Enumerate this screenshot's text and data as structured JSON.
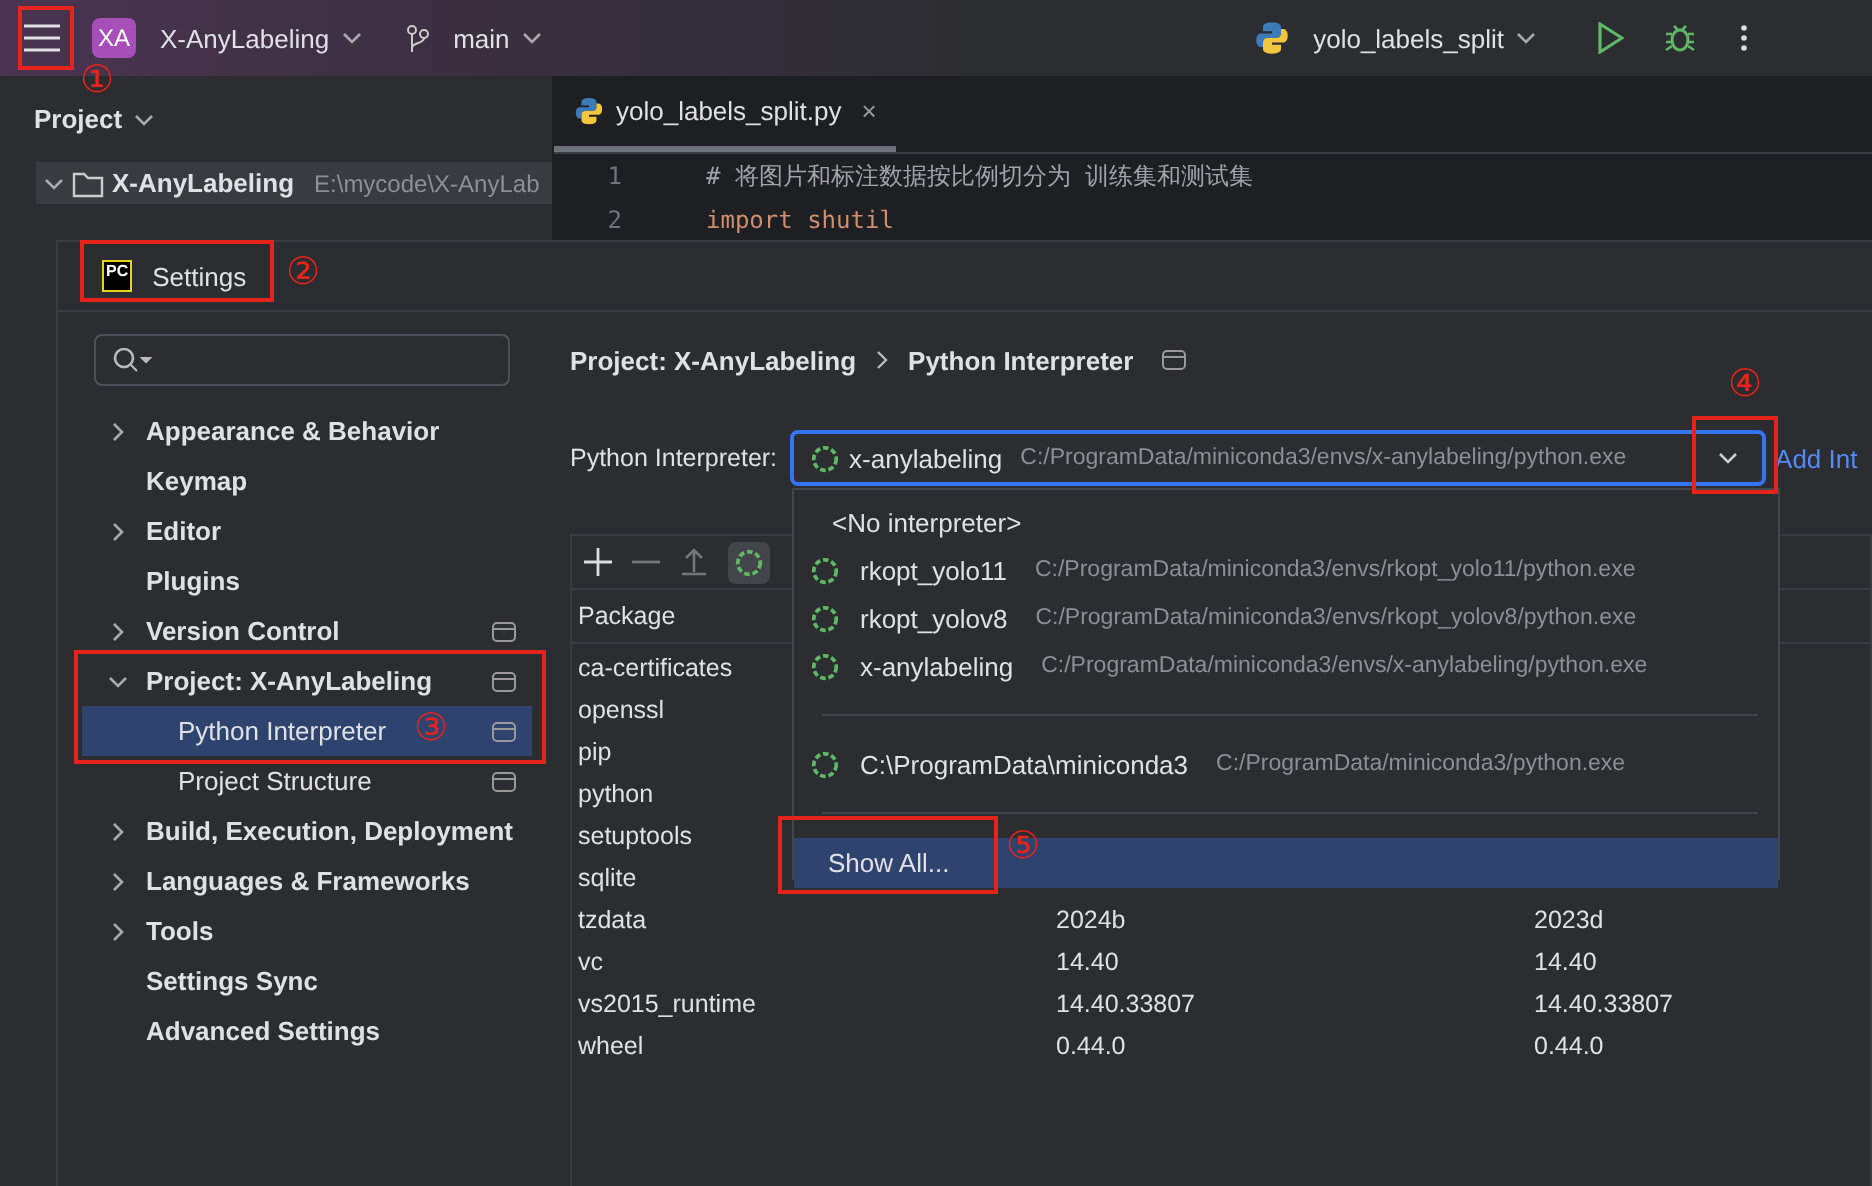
{
  "top_bar": {
    "project_badge": "XA",
    "project": "X-AnyLabeling",
    "branch": "main",
    "run_config": "yolo_labels_split"
  },
  "project_panel": {
    "title": "Project",
    "tree": [
      {
        "name": "X-AnyLabeling",
        "path": "E:\\mycode\\X-AnyLab",
        "expanded": true
      }
    ]
  },
  "editor": {
    "tabs": [
      {
        "label": "yolo_labels_split.py",
        "close": "×",
        "selected": true
      }
    ],
    "lines": [
      {
        "number": "1",
        "text": "# 将图片和标注数据按比例切分为 训练集和测试集",
        "kind": "comment"
      },
      {
        "number": "2",
        "text": "import shutil",
        "kind": "code"
      }
    ]
  },
  "settings": {
    "icon_text": "PC",
    "title": "Settings",
    "nav": [
      {
        "label": "Appearance & Behavior",
        "kind": "group",
        "expanded": false,
        "project_level": false,
        "selected": false
      },
      {
        "label": "Keymap",
        "kind": "page",
        "project_level": false,
        "selected": false
      },
      {
        "label": "Editor",
        "kind": "group",
        "expanded": false,
        "project_level": false,
        "selected": false
      },
      {
        "label": "Plugins",
        "kind": "page",
        "project_level": false,
        "selected": false
      },
      {
        "label": "Version Control",
        "kind": "group",
        "expanded": false,
        "project_level": true,
        "selected": false
      },
      {
        "label": "Project: X-AnyLabeling",
        "kind": "group",
        "expanded": true,
        "project_level": true,
        "selected": false,
        "children": [
          {
            "label": "Python Interpreter",
            "project_level": true,
            "selected": true
          },
          {
            "label": "Project Structure",
            "project_level": true,
            "selected": false
          }
        ]
      },
      {
        "label": "Build, Execution, Deployment",
        "kind": "group",
        "expanded": false,
        "project_level": false,
        "selected": false
      },
      {
        "label": "Languages & Frameworks",
        "kind": "group",
        "expanded": false,
        "project_level": false,
        "selected": false
      },
      {
        "label": "Tools",
        "kind": "group",
        "expanded": false,
        "project_level": false,
        "selected": false
      },
      {
        "label": "Settings Sync",
        "kind": "page",
        "project_level": false,
        "selected": false
      },
      {
        "label": "Advanced Settings",
        "kind": "page",
        "project_level": false,
        "selected": false
      }
    ],
    "breadcrumb": [
      "Project: X-AnyLabeling",
      "Python Interpreter"
    ],
    "interpreter": {
      "label": "Python Interpreter:",
      "name": "x-anylabeling",
      "path": "C:/ProgramData/miniconda3/envs/x-anylabeling/python.exe",
      "add_link": "Add Int"
    },
    "packages": {
      "columns": [
        "Package"
      ],
      "rows": [
        {
          "cells": [
            "ca-certificates"
          ]
        },
        {
          "cells": [
            "openssl"
          ]
        },
        {
          "cells": [
            "pip"
          ]
        },
        {
          "cells": [
            "python"
          ]
        },
        {
          "cells": [
            "setuptools"
          ]
        },
        {
          "cells": [
            "sqlite"
          ]
        },
        {
          "cells": [
            "tzdata",
            "2024b",
            "2023d"
          ]
        },
        {
          "cells": [
            "vc",
            "14.40",
            "14.40"
          ]
        },
        {
          "cells": [
            "vs2015_runtime",
            "14.40.33807",
            "14.40.33807"
          ]
        },
        {
          "cells": [
            "wheel",
            "0.44.0",
            "0.44.0"
          ]
        }
      ]
    },
    "interpreter_menu": [
      {
        "kind": "none",
        "name": "<No interpreter>",
        "selected": false
      },
      {
        "kind": "env",
        "name": "rkopt_yolo11",
        "path": "C:/ProgramData/miniconda3/envs/rkopt_yolo11/python.exe",
        "selected": false
      },
      {
        "kind": "env",
        "name": "rkopt_yolov8",
        "path": "C:/ProgramData/miniconda3/envs/rkopt_yolov8/python.exe",
        "selected": false
      },
      {
        "kind": "env",
        "name": "x-anylabeling",
        "path": "C:/ProgramData/miniconda3/envs/x-anylabeling/python.exe",
        "selected": false
      },
      {
        "kind": "separator"
      },
      {
        "kind": "env",
        "name": "C:\\ProgramData\\miniconda3",
        "path": "C:/ProgramData/miniconda3/python.exe",
        "selected": false
      },
      {
        "kind": "separator"
      },
      {
        "kind": "action",
        "name": "Show All...",
        "selected": true
      }
    ]
  },
  "annotations": [
    {
      "label": "①"
    },
    {
      "label": "②"
    },
    {
      "label": "③"
    },
    {
      "label": "④"
    },
    {
      "label": "⑤"
    }
  ]
}
